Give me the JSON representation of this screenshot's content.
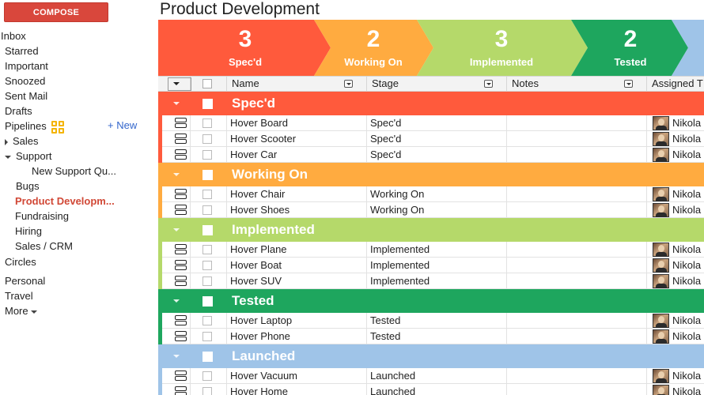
{
  "sidebar": {
    "compose_label": "COMPOSE",
    "items": [
      {
        "label": "Inbox"
      },
      {
        "label": "Starred"
      },
      {
        "label": "Important"
      },
      {
        "label": "Snoozed"
      },
      {
        "label": "Sent Mail"
      },
      {
        "label": "Drafts"
      },
      {
        "label": "Pipelines"
      },
      {
        "label": "Sales"
      },
      {
        "label": "Support"
      },
      {
        "label": "New Support Qu..."
      },
      {
        "label": "Bugs"
      },
      {
        "label": "Product Developm..."
      },
      {
        "label": "Fundraising"
      },
      {
        "label": "Hiring"
      },
      {
        "label": "Sales / CRM"
      },
      {
        "label": "Circles"
      },
      {
        "label": "Personal"
      },
      {
        "label": "Travel"
      },
      {
        "label": "More"
      }
    ],
    "new_label": "+ New",
    "pipelines_icon": "grid-icon"
  },
  "page": {
    "title": "Product Development"
  },
  "stages": [
    {
      "count": "3",
      "label": "Spec'd",
      "color": "#ff5a3c"
    },
    {
      "count": "2",
      "label": "Working On",
      "color": "#ffab40"
    },
    {
      "count": "3",
      "label": "Implemented",
      "color": "#b5d96a"
    },
    {
      "count": "2",
      "label": "Tested",
      "color": "#1ea65e"
    },
    {
      "count": "",
      "label": "",
      "color": "#9fc4e8"
    }
  ],
  "columns": {
    "name": "Name",
    "stage": "Stage",
    "notes": "Notes",
    "assigned": "Assigned T"
  },
  "groups": [
    {
      "name": "Spec'd",
      "color": "#ff5a3c",
      "rows": [
        {
          "name": "Hover Board",
          "stage": "Spec'd",
          "owner": "Nikola"
        },
        {
          "name": "Hover Scooter",
          "stage": "Spec'd",
          "owner": "Nikola"
        },
        {
          "name": "Hover Car",
          "stage": "Spec'd",
          "owner": "Nikola"
        }
      ]
    },
    {
      "name": "Working On",
      "color": "#ffab40",
      "rows": [
        {
          "name": "Hover Chair",
          "stage": "Working On",
          "owner": "Nikola"
        },
        {
          "name": "Hover Shoes",
          "stage": "Working On",
          "owner": "Nikola"
        }
      ]
    },
    {
      "name": "Implemented",
      "color": "#b5d96a",
      "rows": [
        {
          "name": "Hover Plane",
          "stage": "Implemented",
          "owner": "Nikola"
        },
        {
          "name": "Hover Boat",
          "stage": "Implemented",
          "owner": "Nikola"
        },
        {
          "name": "Hover SUV",
          "stage": "Implemented",
          "owner": "Nikola"
        }
      ]
    },
    {
      "name": "Tested",
      "color": "#1ea65e",
      "rows": [
        {
          "name": "Hover Laptop",
          "stage": "Tested",
          "owner": "Nikola"
        },
        {
          "name": "Hover Phone",
          "stage": "Tested",
          "owner": "Nikola"
        }
      ]
    },
    {
      "name": "Launched",
      "color": "#9fc4e8",
      "rows": [
        {
          "name": "Hover Vacuum",
          "stage": "Launched",
          "owner": "Nikola"
        },
        {
          "name": "Hover Home",
          "stage": "Launched",
          "owner": "Nikola"
        }
      ]
    }
  ]
}
